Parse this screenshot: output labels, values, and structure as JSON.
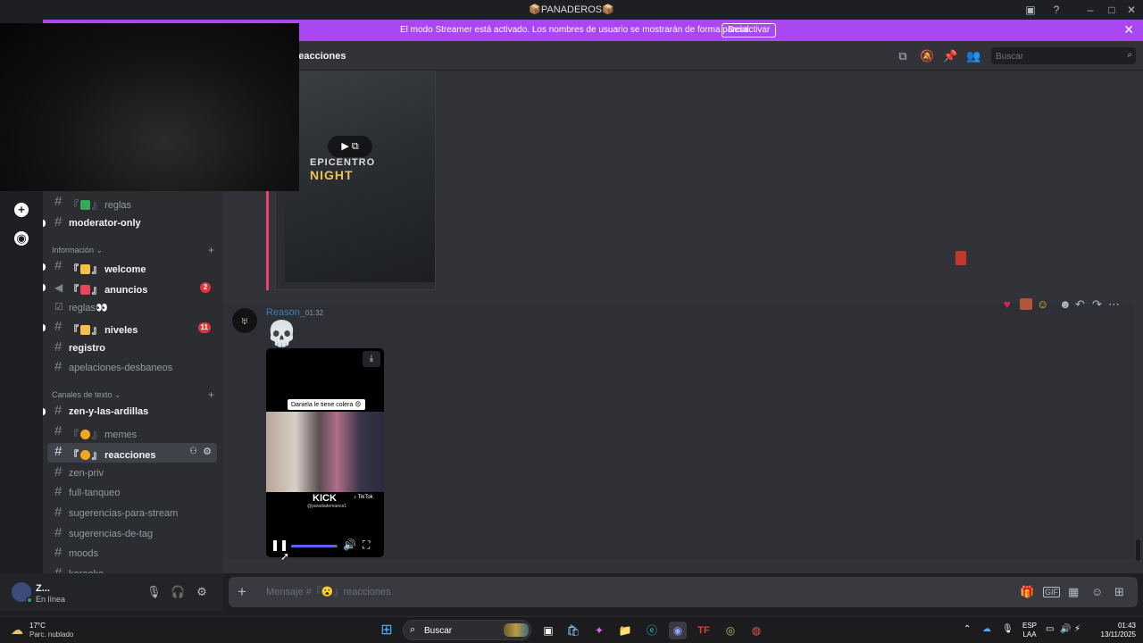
{
  "window": {
    "title": "📦PANADEROS📦"
  },
  "streamer_banner": {
    "message": "El modo Streamer está activado. Los nombres de usuario se mostrarán de forma parcial.",
    "button": "Desactivar"
  },
  "sidebar": {
    "channels_top": [
      {
        "name": "reglas",
        "prefix": "『",
        "suffix": "』",
        "emoji_color": "#3ba55c",
        "unread": false
      },
      {
        "name": "moderator-only",
        "prefix": "",
        "suffix": "",
        "unread": true
      }
    ],
    "category_info": "Información",
    "channels_info": [
      {
        "name": "welcome",
        "prefix": "『",
        "suffix": "』",
        "emoji_color": "#f5c04a",
        "icon": "hash",
        "unread": true,
        "badge": ""
      },
      {
        "name": "anuncios",
        "prefix": "『",
        "suffix": "』",
        "emoji_color": "#e3475b",
        "icon": "megaphone",
        "unread": true,
        "badge": "2"
      },
      {
        "name": "reglas👀",
        "prefix": "",
        "suffix": "",
        "icon": "rules",
        "unread": false,
        "badge": ""
      },
      {
        "name": "niveles",
        "prefix": "『",
        "suffix": "』",
        "emoji_color": "#f5c04a",
        "icon": "hash",
        "unread": true,
        "badge": "11"
      },
      {
        "name": "registro",
        "prefix": "",
        "suffix": "",
        "icon": "hash",
        "unread": true,
        "badge": ""
      },
      {
        "name": "apelaciones-desbaneos",
        "prefix": "",
        "suffix": "",
        "icon": "hash",
        "unread": false,
        "badge": ""
      }
    ],
    "category_text": "Canales de texto",
    "channels_text": [
      {
        "name": "zen-y-las-ardillas",
        "unread": true
      },
      {
        "name": "memes",
        "prefix": "『",
        "suffix": "』",
        "emoji_color": "#f5a623",
        "unread": false
      },
      {
        "name": "reacciones",
        "prefix": "『",
        "suffix": "』",
        "emoji_color": "#f5a623",
        "unread": true,
        "selected": true
      },
      {
        "name": "zen-priv",
        "unread": false
      },
      {
        "name": "full-tanqueo",
        "unread": false
      },
      {
        "name": "sugerencias-para-stream",
        "unread": false
      },
      {
        "name": "sugerencias-de-tag",
        "unread": false
      },
      {
        "name": "moods",
        "unread": false
      },
      {
        "name": "karaoke",
        "unread": false
      }
    ]
  },
  "user": {
    "name": "Z...",
    "status": "En línea"
  },
  "header": {
    "channel": "reacciones",
    "search_placeholder": "Buscar"
  },
  "message": {
    "author": "Reason_",
    "time": "01:32",
    "skull": "💀",
    "video_caption": "Daniela le tiene colera 😠",
    "video_brand": "KICK",
    "video_tiktok": "♪ TikTok",
    "video_handle": "@paradademanos1",
    "volume": 0.9
  },
  "first_video": {
    "overlay_text": "EPICENTRO",
    "overlay_text2": "NIGHT"
  },
  "composer": {
    "placeholder": "Mensaje #『😮』reacciones"
  },
  "taskbar": {
    "temp": "17°C",
    "weather": "Parc. nublado",
    "search": "Buscar",
    "lang1": "ESP",
    "lang2": "LAA",
    "time": "01:43",
    "date": "13/11/2025"
  }
}
